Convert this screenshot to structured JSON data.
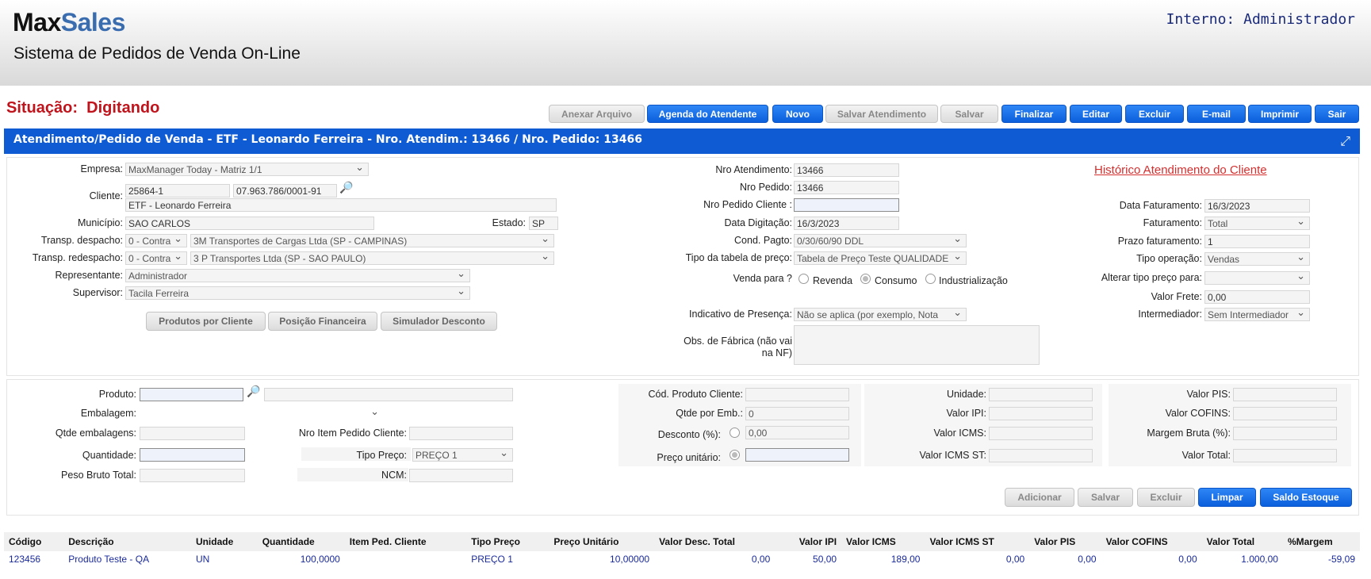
{
  "header": {
    "logo_part1": "Max",
    "logo_part2": "Sales",
    "system_title": "Sistema de Pedidos de Venda On-Line",
    "user": "Interno: Administrador"
  },
  "status": {
    "label": "Situação:",
    "value": "Digitando"
  },
  "toolbar": {
    "anexar": "Anexar Arquivo",
    "agenda": "Agenda do Atendente",
    "novo": "Novo",
    "salvar_atend": "Salvar Atendimento",
    "salvar": "Salvar",
    "finalizar": "Finalizar",
    "editar": "Editar",
    "excluir": "Excluir",
    "email": "E-mail",
    "imprimir": "Imprimir",
    "sair": "Sair"
  },
  "title_bar": "Atendimento/Pedido de Venda - ETF - Leonardo Ferreira - Nro. Atendim.: 13466 / Nro. Pedido: 13466",
  "order": {
    "empresa_label": "Empresa:",
    "empresa": "MaxManager Today - Matriz 1/1",
    "cliente_label": "Cliente:",
    "cliente_code": "25864-1",
    "cliente_cnpj": "07.963.786/0001-91",
    "cliente_name": "ETF - Leonardo Ferreira",
    "municipio_label": "Município:",
    "municipio": "SAO CARLOS",
    "estado_label": "Estado:",
    "estado": "SP",
    "transp_desp_label": "Transp. despacho:",
    "transp_desp_type": "0 - Contra",
    "transp_desp": "3M Transportes de Cargas Ltda (SP - CAMPINAS)",
    "transp_redesp_label": "Transp. redespacho:",
    "transp_redesp_type": "0 - Contra",
    "transp_redesp": "3 P Transportes Ltda (SP - SAO PAULO)",
    "representante_label": "Representante:",
    "representante": "Administrador",
    "supervisor_label": "Supervisor:",
    "supervisor": "Tacila Ferreira",
    "btn_produtos": "Produtos por Cliente",
    "btn_posicao": "Posição Financeira",
    "btn_simulador": "Simulador Desconto",
    "nro_atend_label": "Nro Atendimento:",
    "nro_atend": "13466",
    "nro_pedido_label": "Nro Pedido:",
    "nro_pedido": "13466",
    "nro_ped_cli_label": "Nro Pedido Cliente :",
    "nro_ped_cli": "",
    "data_dig_label": "Data Digitação:",
    "data_dig": "16/3/2023",
    "cond_pagto_label": "Cond. Pagto:",
    "cond_pagto": "0/30/60/90 DDL",
    "tipo_tabela_label": "Tipo da tabela de preço:",
    "tipo_tabela": "Tabela de Preço Teste QUALIDADE",
    "venda_para_label": "Venda para ?",
    "revenda": "Revenda",
    "consumo": "Consumo",
    "industrializacao": "Industrialização",
    "indicativo_label": "Indicativo de Presença:",
    "indicativo": "Não se aplica (por exemplo, Nota",
    "obs_label": "Obs. de Fábrica (não vai na NF)",
    "historico": "Histórico Atendimento do Cliente",
    "data_fat_label": "Data Faturamento:",
    "data_fat": "16/3/2023",
    "faturamento_label": "Faturamento:",
    "faturamento": "Total",
    "prazo_label": "Prazo faturamento:",
    "prazo": "1",
    "tipo_op_label": "Tipo operação:",
    "tipo_op": "Vendas",
    "alterar_label": "Alterar tipo preço para:",
    "alterar": "",
    "frete_label": "Valor Frete:",
    "frete": "0,00",
    "intermediador_label": "Intermediador:",
    "intermediador": "Sem Intermediador"
  },
  "item": {
    "produto_label": "Produto:",
    "produto": "",
    "produto_desc": "",
    "embalagem_label": "Embalagem:",
    "embalagem": "",
    "qtde_emb_label": "Qtde embalagens:",
    "qtde_emb": "",
    "nro_item_label": "Nro Item Pedido Cliente:",
    "nro_item": "",
    "quantidade_label": "Quantidade:",
    "quantidade": "",
    "tipo_preco_label": "Tipo Preço:",
    "tipo_preco": "PREÇO 1",
    "peso_label": "Peso Bruto Total:",
    "peso": "",
    "ncm_label": "NCM:",
    "ncm": "",
    "cod_cli_label": "Cód. Produto Cliente:",
    "cod_cli": "",
    "qtde_por_emb_label": "Qtde por Emb.:",
    "qtde_por_emb": "0",
    "desconto_label": "Desconto (%):",
    "desconto": "0,00",
    "preco_unit_label": "Preço unitário:",
    "preco_unit": "",
    "unidade_label": "Unidade:",
    "unidade": "",
    "ipi_label": "Valor IPI:",
    "ipi": "",
    "icms_label": "Valor ICMS:",
    "icms": "",
    "icms_st_label": "Valor ICMS ST:",
    "icms_st": "",
    "pis_label": "Valor PIS:",
    "pis": "",
    "cofins_label": "Valor COFINS:",
    "cofins": "",
    "margem_label": "Margem Bruta (%):",
    "margem": "",
    "total_label": "Valor Total:",
    "total": "",
    "btn_adicionar": "Adicionar",
    "btn_salvar": "Salvar",
    "btn_excluir": "Excluir",
    "btn_limpar": "Limpar",
    "btn_saldo": "Saldo Estoque"
  },
  "grid": {
    "headers": [
      "Código",
      "Descrição",
      "Unidade",
      "Quantidade",
      "Item Ped. Cliente",
      "Tipo Preço",
      "Preço Unitário",
      "Valor Desc. Total",
      "Valor IPI",
      "Valor ICMS",
      "Valor ICMS ST",
      "Valor PIS",
      "Valor COFINS",
      "Valor Total",
      "%Margem"
    ],
    "rows": [
      [
        "123456",
        "Produto Teste - QA",
        "UN",
        "100,0000",
        "",
        "PREÇO 1",
        "10,00000",
        "0,00",
        "50,00",
        "189,00",
        "0,00",
        "0,00",
        "0,00",
        "1.000,00",
        "-59,09"
      ]
    ]
  }
}
